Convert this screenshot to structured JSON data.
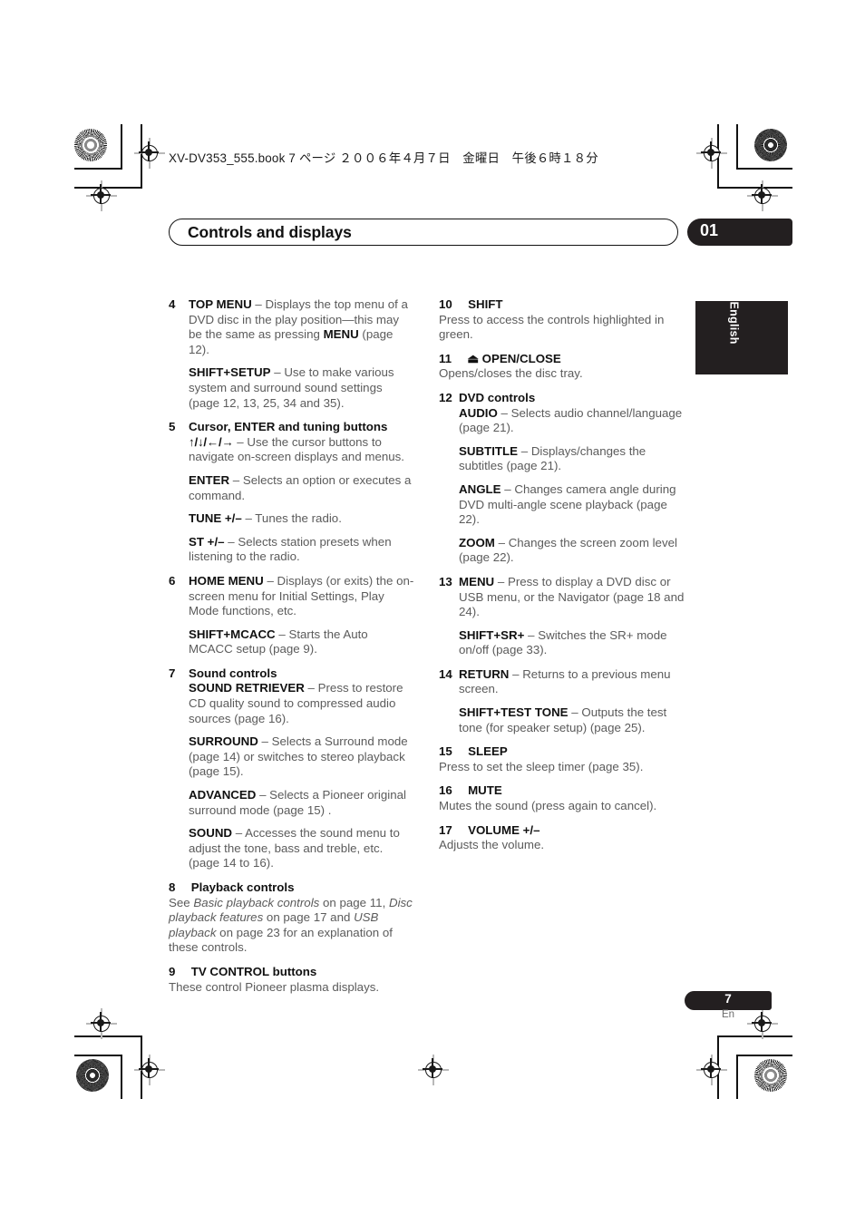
{
  "print_marks": {
    "book_line": "XV-DV353_555.book  7 ページ  ２００６年４月７日　金曜日　午後６時１８分"
  },
  "header": {
    "chapter_title": "Controls and displays",
    "chapter_number": "01"
  },
  "side_tab": {
    "label": "English"
  },
  "footer": {
    "page_number": "7",
    "language": "En"
  },
  "left_column": [
    {
      "num": "4",
      "layout": "hang",
      "paragraphs": [
        {
          "term": "TOP MENU",
          "dash": " – ",
          "text": "Displays the top menu of a DVD disc in the play position—this may be the same as pressing ",
          "term2": "MENU",
          "text2": " (page 12)."
        },
        {
          "term": "SHIFT+SETUP",
          "dash": " – ",
          "text": "Use to make various system and surround sound settings (page 12, 13, 25, 34 and 35)."
        }
      ]
    },
    {
      "num": "5",
      "layout": "hang",
      "heading": "Cursor, ENTER and tuning buttons",
      "paragraphs": [
        {
          "arrows": "↑/↓/←/→",
          "dash": " – ",
          "text": "Use the cursor buttons to navigate on-screen displays and menus.",
          "tight": true
        },
        {
          "term": "ENTER",
          "dash": " – ",
          "text": "Selects an option or executes a command."
        },
        {
          "term": "TUNE +/–",
          "dash": " – ",
          "text": "Tunes the radio."
        },
        {
          "term": "ST +/–",
          "dash": " – ",
          "text": "Selects station presets when listening to the radio."
        }
      ]
    },
    {
      "num": "6",
      "layout": "hang",
      "paragraphs": [
        {
          "term": "HOME MENU",
          "dash": " – ",
          "text": "Displays (or exits) the on-screen menu for Initial Settings, Play Mode functions, etc."
        },
        {
          "term": "SHIFT+MCACC",
          "dash": " – ",
          "text": "Starts the Auto MCACC setup (page 9)."
        }
      ]
    },
    {
      "num": "7",
      "layout": "hang",
      "heading": "Sound controls",
      "paragraphs": [
        {
          "term": "SOUND RETRIEVER",
          "dash": " – ",
          "text": "Press to restore CD quality sound to compressed audio sources (page 16).",
          "tight": true
        },
        {
          "term": "SURROUND",
          "dash": " – ",
          "text": "Selects a Surround mode (page 14) or switches to stereo playback (page 15)."
        },
        {
          "term": "ADVANCED",
          "dash": " – ",
          "text": "Selects a Pioneer original surround mode (page 15) ."
        },
        {
          "term": "SOUND",
          "dash": " – ",
          "text": "Accesses the sound menu to adjust the tone, bass and treble, etc. (page 14 to 16)."
        }
      ]
    },
    {
      "num": "8",
      "layout": "flat",
      "heading": "Playback controls",
      "body_parts": [
        {
          "kind": "plain",
          "text": "See "
        },
        {
          "kind": "italic",
          "text": "Basic playback controls"
        },
        {
          "kind": "plain",
          "text": " on page 11, "
        },
        {
          "kind": "italic",
          "text": "Disc playback features"
        },
        {
          "kind": "plain",
          "text": " on page 17 and "
        },
        {
          "kind": "italic",
          "text": "USB playback"
        },
        {
          "kind": "plain",
          "text": " on page 23 for an explanation of these controls."
        }
      ]
    },
    {
      "num": "9",
      "layout": "flat",
      "heading": "TV CONTROL buttons",
      "body": "These control Pioneer plasma displays."
    }
  ],
  "right_column": [
    {
      "num": "10",
      "layout": "flat",
      "heading": "SHIFT",
      "body": "Press to access the controls highlighted in green."
    },
    {
      "num": "11",
      "layout": "flat",
      "heading": "⏏ OPEN/CLOSE",
      "body": "Opens/closes the disc tray."
    },
    {
      "num": "12",
      "layout": "hang",
      "heading": "DVD controls",
      "paragraphs": [
        {
          "term": "AUDIO",
          "dash": " – ",
          "text": "Selects audio channel/language (page 21).",
          "tight": true
        },
        {
          "term": "SUBTITLE",
          "dash": " – ",
          "text": "Displays/changes the subtitles (page 21)."
        },
        {
          "term": "ANGLE",
          "dash": " – ",
          "text": "Changes camera angle during DVD multi-angle scene playback (page 22)."
        },
        {
          "term": "ZOOM",
          "dash": " – ",
          "text": "Changes the screen zoom level (page 22)."
        }
      ]
    },
    {
      "num": "13",
      "layout": "hang",
      "paragraphs": [
        {
          "term": "MENU",
          "dash": " – ",
          "text": "Press to display a DVD disc or USB menu, or the Navigator (page 18 and 24)."
        },
        {
          "term": "SHIFT+SR+",
          "dash": " – ",
          "text": "Switches the SR+ mode on/off (page 33)."
        }
      ]
    },
    {
      "num": "14",
      "layout": "hang",
      "paragraphs": [
        {
          "term": "RETURN",
          "dash": " – ",
          "text": "Returns to a previous menu screen."
        },
        {
          "term": "SHIFT+TEST TONE",
          "dash": " – ",
          "text": "Outputs the test tone (for speaker setup) (page 25)."
        }
      ]
    },
    {
      "num": "15",
      "layout": "flat",
      "heading": "SLEEP",
      "body": "Press to set the sleep timer (page 35)."
    },
    {
      "num": "16",
      "layout": "flat",
      "heading": "MUTE",
      "body": "Mutes the sound (press again to cancel)."
    },
    {
      "num": "17",
      "layout": "flat",
      "heading": "VOLUME +/–",
      "body": "Adjusts the volume."
    }
  ]
}
